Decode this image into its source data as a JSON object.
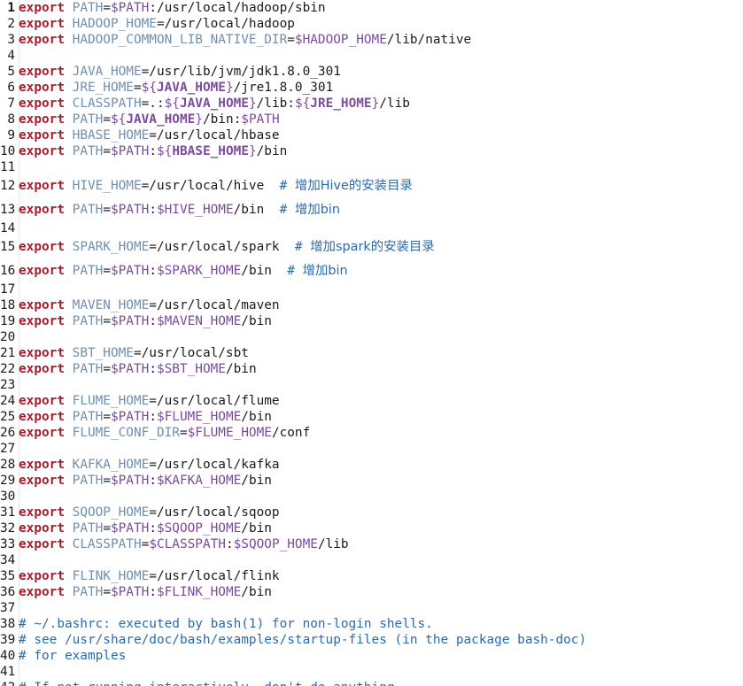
{
  "editor": {
    "lines": [
      {
        "n": "1",
        "bold": true,
        "parts": [
          [
            "kw",
            "export"
          ],
          [
            "plain",
            " "
          ],
          [
            "vname",
            "PATH"
          ],
          [
            "plain",
            "="
          ],
          [
            "sigil",
            "$PATH"
          ],
          [
            "plain",
            ":/usr/local/hadoop/sbin"
          ]
        ]
      },
      {
        "n": "2",
        "parts": [
          [
            "kw",
            "export"
          ],
          [
            "plain",
            " "
          ],
          [
            "vname",
            "HADOOP_HOME"
          ],
          [
            "plain",
            "=/usr/local/hadoop"
          ]
        ]
      },
      {
        "n": "3",
        "parts": [
          [
            "kw",
            "export"
          ],
          [
            "plain",
            " "
          ],
          [
            "vname",
            "HADOOP_COMMON_LIB_NATIVE_DIR"
          ],
          [
            "plain",
            "="
          ],
          [
            "sigil",
            "$HADOOP_HOME"
          ],
          [
            "plain",
            "/lib/native"
          ]
        ]
      },
      {
        "n": "4",
        "parts": []
      },
      {
        "n": "5",
        "parts": [
          [
            "kw",
            "export"
          ],
          [
            "plain",
            " "
          ],
          [
            "vname",
            "JAVA_HOME"
          ],
          [
            "plain",
            "=/usr/lib/jvm/jdk1.8.0_301"
          ]
        ]
      },
      {
        "n": "6",
        "parts": [
          [
            "kw",
            "export"
          ],
          [
            "plain",
            " "
          ],
          [
            "vname",
            "JRE_HOME"
          ],
          [
            "plain",
            "="
          ],
          [
            "sigil",
            "${"
          ],
          [
            "kwv",
            "JAVA_HOME"
          ],
          [
            "sigil",
            "}"
          ],
          [
            "plain",
            "/jre1.8.0_301"
          ]
        ]
      },
      {
        "n": "7",
        "parts": [
          [
            "kw",
            "export"
          ],
          [
            "plain",
            " "
          ],
          [
            "vname",
            "CLASSPATH"
          ],
          [
            "plain",
            "=.:"
          ],
          [
            "sigil",
            "${"
          ],
          [
            "kwv",
            "JAVA_HOME"
          ],
          [
            "sigil",
            "}"
          ],
          [
            "plain",
            "/lib:"
          ],
          [
            "sigil",
            "${"
          ],
          [
            "kwv",
            "JRE_HOME"
          ],
          [
            "sigil",
            "}"
          ],
          [
            "plain",
            "/lib"
          ]
        ]
      },
      {
        "n": "8",
        "parts": [
          [
            "kw",
            "export"
          ],
          [
            "plain",
            " "
          ],
          [
            "vname",
            "PATH"
          ],
          [
            "plain",
            "="
          ],
          [
            "sigil",
            "${"
          ],
          [
            "kwv",
            "JAVA_HOME"
          ],
          [
            "sigil",
            "}"
          ],
          [
            "plain",
            "/bin:"
          ],
          [
            "sigil",
            "$PATH"
          ]
        ]
      },
      {
        "n": "9",
        "parts": [
          [
            "kw",
            "export"
          ],
          [
            "plain",
            " "
          ],
          [
            "vname",
            "HBASE_HOME"
          ],
          [
            "plain",
            "=/usr/local/hbase"
          ]
        ]
      },
      {
        "n": "10",
        "parts": [
          [
            "kw",
            "export"
          ],
          [
            "plain",
            " "
          ],
          [
            "vname",
            "PATH"
          ],
          [
            "plain",
            "="
          ],
          [
            "sigil",
            "$PATH"
          ],
          [
            "plain",
            ":"
          ],
          [
            "sigil",
            "${"
          ],
          [
            "kwv",
            "HBASE_HOME"
          ],
          [
            "sigil",
            "}"
          ],
          [
            "plain",
            "/bin"
          ]
        ]
      },
      {
        "n": "11",
        "parts": []
      },
      {
        "n": "12",
        "parts": [
          [
            "kw",
            "export"
          ],
          [
            "plain",
            " "
          ],
          [
            "vname",
            "HIVE_HOME"
          ],
          [
            "plain",
            "=/usr/local/hive  "
          ],
          [
            "cmt",
            "# "
          ],
          [
            "cjk",
            "增加Hive的安装目录"
          ]
        ]
      },
      {
        "n": "13",
        "parts": [
          [
            "kw",
            "export"
          ],
          [
            "plain",
            " "
          ],
          [
            "vname",
            "PATH"
          ],
          [
            "plain",
            "="
          ],
          [
            "sigil",
            "$PATH"
          ],
          [
            "plain",
            ":"
          ],
          [
            "sigil",
            "$HIVE_HOME"
          ],
          [
            "plain",
            "/bin  "
          ],
          [
            "cmt",
            "# "
          ],
          [
            "cjk",
            "增加bin"
          ]
        ]
      },
      {
        "n": "14",
        "parts": []
      },
      {
        "n": "15",
        "parts": [
          [
            "kw",
            "export"
          ],
          [
            "plain",
            " "
          ],
          [
            "vname",
            "SPARK_HOME"
          ],
          [
            "plain",
            "=/usr/local/spark  "
          ],
          [
            "cmt",
            "# "
          ],
          [
            "cjk",
            "增加spark的安装目录"
          ]
        ]
      },
      {
        "n": "16",
        "parts": [
          [
            "kw",
            "export"
          ],
          [
            "plain",
            " "
          ],
          [
            "vname",
            "PATH"
          ],
          [
            "plain",
            "="
          ],
          [
            "sigil",
            "$PATH"
          ],
          [
            "plain",
            ":"
          ],
          [
            "sigil",
            "$SPARK_HOME"
          ],
          [
            "plain",
            "/bin  "
          ],
          [
            "cmt",
            "# "
          ],
          [
            "cjk",
            "增加bin"
          ]
        ]
      },
      {
        "n": "17",
        "parts": []
      },
      {
        "n": "18",
        "parts": [
          [
            "kw",
            "export"
          ],
          [
            "plain",
            " "
          ],
          [
            "vname",
            "MAVEN_HOME"
          ],
          [
            "plain",
            "=/usr/local/maven"
          ]
        ]
      },
      {
        "n": "19",
        "parts": [
          [
            "kw",
            "export"
          ],
          [
            "plain",
            " "
          ],
          [
            "vname",
            "PATH"
          ],
          [
            "plain",
            "="
          ],
          [
            "sigil",
            "$PATH"
          ],
          [
            "plain",
            ":"
          ],
          [
            "sigil",
            "$MAVEN_HOME"
          ],
          [
            "plain",
            "/bin"
          ]
        ]
      },
      {
        "n": "20",
        "parts": []
      },
      {
        "n": "21",
        "parts": [
          [
            "kw",
            "export"
          ],
          [
            "plain",
            " "
          ],
          [
            "vname",
            "SBT_HOME"
          ],
          [
            "plain",
            "=/usr/local/sbt"
          ]
        ]
      },
      {
        "n": "22",
        "parts": [
          [
            "kw",
            "export"
          ],
          [
            "plain",
            " "
          ],
          [
            "vname",
            "PATH"
          ],
          [
            "plain",
            "="
          ],
          [
            "sigil",
            "$PATH"
          ],
          [
            "plain",
            ":"
          ],
          [
            "sigil",
            "$SBT_HOME"
          ],
          [
            "plain",
            "/bin"
          ]
        ]
      },
      {
        "n": "23",
        "parts": []
      },
      {
        "n": "24",
        "parts": [
          [
            "kw",
            "export"
          ],
          [
            "plain",
            " "
          ],
          [
            "vname",
            "FLUME_HOME"
          ],
          [
            "plain",
            "=/usr/local/flume"
          ]
        ]
      },
      {
        "n": "25",
        "parts": [
          [
            "kw",
            "export"
          ],
          [
            "plain",
            " "
          ],
          [
            "vname",
            "PATH"
          ],
          [
            "plain",
            "="
          ],
          [
            "sigil",
            "$PATH"
          ],
          [
            "plain",
            ":"
          ],
          [
            "sigil",
            "$FLUME_HOME"
          ],
          [
            "plain",
            "/bin"
          ]
        ]
      },
      {
        "n": "26",
        "parts": [
          [
            "kw",
            "export"
          ],
          [
            "plain",
            " "
          ],
          [
            "vname",
            "FLUME_CONF_DIR"
          ],
          [
            "plain",
            "="
          ],
          [
            "sigil",
            "$FLUME_HOME"
          ],
          [
            "plain",
            "/conf"
          ]
        ]
      },
      {
        "n": "27",
        "parts": []
      },
      {
        "n": "28",
        "parts": [
          [
            "kw",
            "export"
          ],
          [
            "plain",
            " "
          ],
          [
            "vname",
            "KAFKA_HOME"
          ],
          [
            "plain",
            "=/usr/local/kafka"
          ]
        ]
      },
      {
        "n": "29",
        "parts": [
          [
            "kw",
            "export"
          ],
          [
            "plain",
            " "
          ],
          [
            "vname",
            "PATH"
          ],
          [
            "plain",
            "="
          ],
          [
            "sigil",
            "$PATH"
          ],
          [
            "plain",
            ":"
          ],
          [
            "sigil",
            "$KAFKA_HOME"
          ],
          [
            "plain",
            "/bin"
          ]
        ]
      },
      {
        "n": "30",
        "parts": []
      },
      {
        "n": "31",
        "parts": [
          [
            "kw",
            "export"
          ],
          [
            "plain",
            " "
          ],
          [
            "vname",
            "SQOOP_HOME"
          ],
          [
            "plain",
            "=/usr/local/sqoop"
          ]
        ]
      },
      {
        "n": "32",
        "parts": [
          [
            "kw",
            "export"
          ],
          [
            "plain",
            " "
          ],
          [
            "vname",
            "PATH"
          ],
          [
            "plain",
            "="
          ],
          [
            "sigil",
            "$PATH"
          ],
          [
            "plain",
            ":"
          ],
          [
            "sigil",
            "$SQOOP_HOME"
          ],
          [
            "plain",
            "/bin"
          ]
        ]
      },
      {
        "n": "33",
        "parts": [
          [
            "kw",
            "export"
          ],
          [
            "plain",
            " "
          ],
          [
            "vname",
            "CLASSPATH"
          ],
          [
            "plain",
            "="
          ],
          [
            "sigil",
            "$CLASSPATH"
          ],
          [
            "plain",
            ":"
          ],
          [
            "sigil",
            "$SQOOP_HOME"
          ],
          [
            "plain",
            "/lib"
          ]
        ]
      },
      {
        "n": "34",
        "parts": []
      },
      {
        "n": "35",
        "parts": [
          [
            "kw",
            "export"
          ],
          [
            "plain",
            " "
          ],
          [
            "vname",
            "FLINK_HOME"
          ],
          [
            "plain",
            "=/usr/local/flink"
          ]
        ]
      },
      {
        "n": "36",
        "parts": [
          [
            "kw",
            "export"
          ],
          [
            "plain",
            " "
          ],
          [
            "vname",
            "PATH"
          ],
          [
            "plain",
            "="
          ],
          [
            "sigil",
            "$PATH"
          ],
          [
            "plain",
            ":"
          ],
          [
            "sigil",
            "$FLINK_HOME"
          ],
          [
            "plain",
            "/bin"
          ]
        ]
      },
      {
        "n": "37",
        "parts": []
      },
      {
        "n": "38",
        "parts": [
          [
            "cmt",
            "# ~/.bashrc: executed by bash(1) for non-login shells."
          ]
        ]
      },
      {
        "n": "39",
        "parts": [
          [
            "cmt",
            "# see /usr/share/doc/bash/examples/startup-files (in the package bash-doc)"
          ]
        ]
      },
      {
        "n": "40",
        "parts": [
          [
            "cmt",
            "# for examples"
          ]
        ]
      },
      {
        "n": "41",
        "parts": []
      },
      {
        "n": "42",
        "parts": [
          [
            "cmt",
            "# If not running interactively, don't do anything"
          ]
        ]
      }
    ]
  },
  "colors": {
    "keyword": "#a51d2d",
    "variable_name": "#6f8fb0",
    "expansion": "#7b4b9e",
    "comment": "#2a6ab0",
    "text": "#1a1a1a",
    "background": "#ffffff"
  }
}
